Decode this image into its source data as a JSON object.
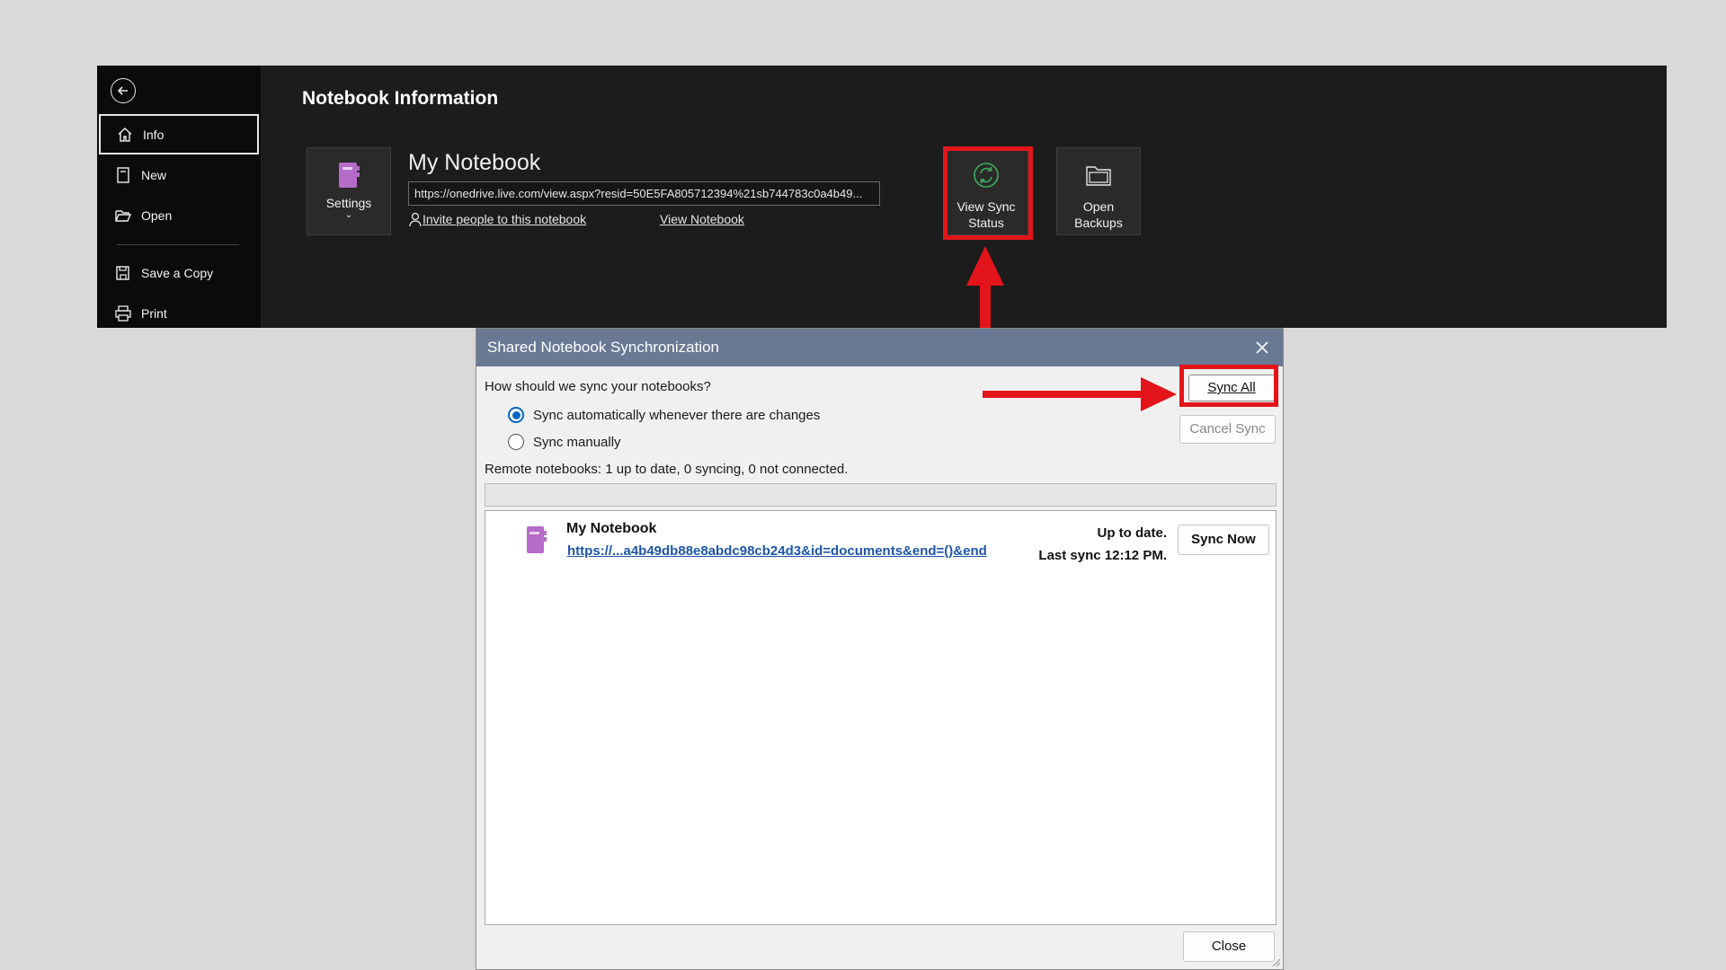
{
  "backstage": {
    "title": "Notebook Information",
    "nav": {
      "back_icon": "back-arrow-icon",
      "items": [
        {
          "label": "Info",
          "icon": "home-icon"
        },
        {
          "label": "New",
          "icon": "new-page-icon"
        },
        {
          "label": "Open",
          "icon": "folder-open-icon"
        },
        {
          "label": "Save a Copy",
          "icon": "save-copy-icon"
        },
        {
          "label": "Print",
          "icon": "printer-icon"
        }
      ]
    },
    "settings_label": "Settings",
    "notebook_name": "My Notebook",
    "notebook_url": "https://onedrive.live.com/view.aspx?resid=50E5FA805712394%21sb744783c0a4b49...",
    "invite_label": "Invite people to this notebook",
    "view_label": "View Notebook",
    "tiles": {
      "sync_line1": "View Sync",
      "sync_line2": "Status",
      "backups_line1": "Open",
      "backups_line2": "Backups"
    }
  },
  "dialog": {
    "title": "Shared Notebook Synchronization",
    "question": "How should we sync your notebooks?",
    "options": [
      {
        "label": "Sync automatically whenever there are changes",
        "selected": true
      },
      {
        "label": "Sync manually",
        "selected": false
      }
    ],
    "remote_status": "Remote notebooks: 1 up to date, 0 syncing, 0 not connected.",
    "progress": 0,
    "buttons": {
      "sync_all": "Sync All",
      "cancel_sync": "Cancel Sync",
      "sync_now": "Sync Now",
      "close": "Close"
    },
    "notebooks": [
      {
        "name": "My Notebook",
        "url": "https://...a4b49db88e8abdc98cb24d3&id=documents&end=()&end",
        "status": "Up to date.",
        "last_sync": "Last sync 12:12 PM."
      }
    ]
  },
  "colors": {
    "highlight": "#e3151b",
    "notebook_purple": "#b46cc8",
    "dialog_titlebar": "#697993",
    "link_blue": "#1e56a8",
    "radio_blue": "#0067c0"
  }
}
